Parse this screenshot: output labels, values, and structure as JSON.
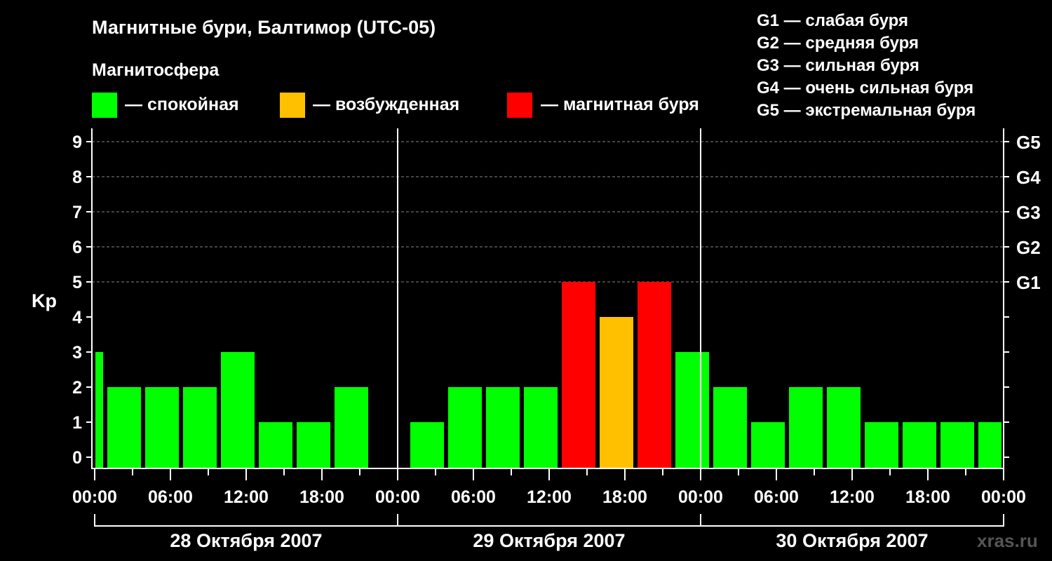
{
  "header": {
    "title": "Магнитные бури, Балтимор (UTC-05)",
    "legend_title": "Магнитосфера",
    "legend": [
      {
        "label": "— спокойная",
        "color": "#00ff00"
      },
      {
        "label": "— возбужденная",
        "color": "#ffc000"
      },
      {
        "label": "— магнитная буря",
        "color": "#ff0000"
      }
    ],
    "g_scale": [
      "G1 — слабая буря",
      "G2 — средняя буря",
      "G3 — сильная буря",
      "G4 — очень сильная буря",
      "G5 — экстремальная буря"
    ]
  },
  "watermark": "xras.ru",
  "chart_data": {
    "type": "bar",
    "title": "Магнитные бури, Балтимор (UTC-05)",
    "ylabel": "Kp",
    "ylim": [
      0,
      9
    ],
    "yticks": [
      "0",
      "1",
      "2",
      "3",
      "4",
      "5",
      "6",
      "7",
      "8",
      "9"
    ],
    "right_ticks": [
      {
        "kp": 5,
        "label": "G1"
      },
      {
        "kp": 6,
        "label": "G2"
      },
      {
        "kp": 7,
        "label": "G3"
      },
      {
        "kp": 8,
        "label": "G4"
      },
      {
        "kp": 9,
        "label": "G5"
      }
    ],
    "xlim_hours": [
      0,
      72
    ],
    "xtick_labels": [
      "00:00",
      "06:00",
      "12:00",
      "18:00",
      "00:00",
      "06:00",
      "12:00",
      "18:00",
      "00:00",
      "06:00",
      "12:00",
      "18:00",
      "00:00"
    ],
    "days": [
      "28 Октября 2007",
      "29 Октября 2007",
      "30 Октября 2007"
    ],
    "bar_hours": 3,
    "bars": [
      {
        "start": -2,
        "kp": 3
      },
      {
        "start": 1,
        "kp": 2
      },
      {
        "start": 4,
        "kp": 2
      },
      {
        "start": 7,
        "kp": 2
      },
      {
        "start": 10,
        "kp": 3
      },
      {
        "start": 13,
        "kp": 1
      },
      {
        "start": 16,
        "kp": 1
      },
      {
        "start": 19,
        "kp": 2
      },
      {
        "start": 22,
        "kp": null
      },
      {
        "start": 25,
        "kp": 1
      },
      {
        "start": 28,
        "kp": 2
      },
      {
        "start": 31,
        "kp": 2
      },
      {
        "start": 34,
        "kp": 2
      },
      {
        "start": 37,
        "kp": 5
      },
      {
        "start": 40,
        "kp": 4
      },
      {
        "start": 43,
        "kp": 5
      },
      {
        "start": 46,
        "kp": 3
      },
      {
        "start": 49,
        "kp": 2
      },
      {
        "start": 52,
        "kp": 1
      },
      {
        "start": 55,
        "kp": 2
      },
      {
        "start": 58,
        "kp": 2
      },
      {
        "start": 61,
        "kp": 1
      },
      {
        "start": 64,
        "kp": 1
      },
      {
        "start": 67,
        "kp": 1
      },
      {
        "start": 70,
        "kp": 1
      }
    ],
    "colors": {
      "quiet": "#00ff00",
      "active": "#ffc000",
      "storm": "#ff0000"
    },
    "grid": true
  }
}
